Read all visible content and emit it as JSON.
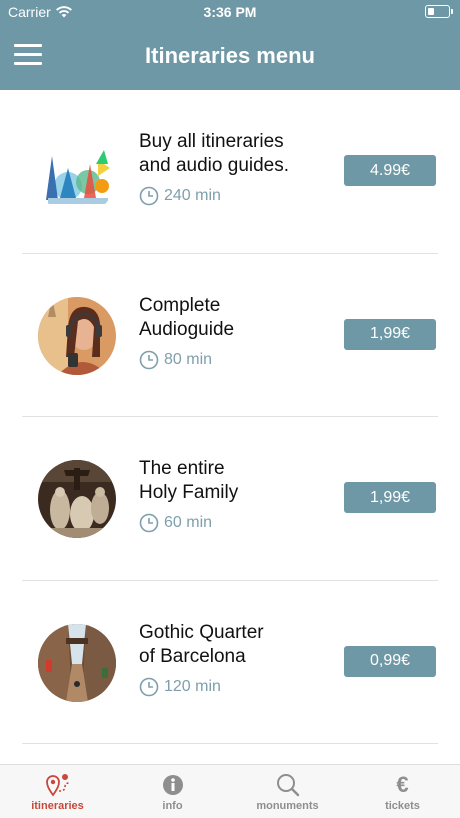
{
  "status_bar": {
    "carrier": "Carrier",
    "time": "3:36 PM"
  },
  "nav": {
    "title": "Itineraries menu",
    "menu_icon": "hamburger-icon"
  },
  "itineraries": [
    {
      "title_line1": "Buy all itineraries",
      "title_line2": "and audio guides.",
      "duration": "240 min",
      "price": "4.99€",
      "image": "barcelona-illustration"
    },
    {
      "title_line1": "Complete",
      "title_line2": "Audioguide",
      "duration": "80 min",
      "price": "1,99€",
      "image": "woman-headphones-photo"
    },
    {
      "title_line1": "The entire",
      "title_line2": "Holy Family",
      "duration": "60 min",
      "price": "1,99€",
      "image": "sculpture-photo"
    },
    {
      "title_line1": "Gothic Quarter",
      "title_line2": "of Barcelona",
      "duration": "120 min",
      "price": "0,99€",
      "image": "gothic-street-photo"
    }
  ],
  "tabs": [
    {
      "label": "itineraries",
      "icon": "map-pin-route-icon",
      "active": true
    },
    {
      "label": "info",
      "icon": "info-icon",
      "active": false
    },
    {
      "label": "monuments",
      "icon": "search-icon",
      "active": false
    },
    {
      "label": "tickets",
      "icon": "euro-icon",
      "active": false
    }
  ],
  "colors": {
    "accent": "#6f98a6",
    "active_tab": "#c9473b",
    "duration_text": "#7e9fab"
  }
}
